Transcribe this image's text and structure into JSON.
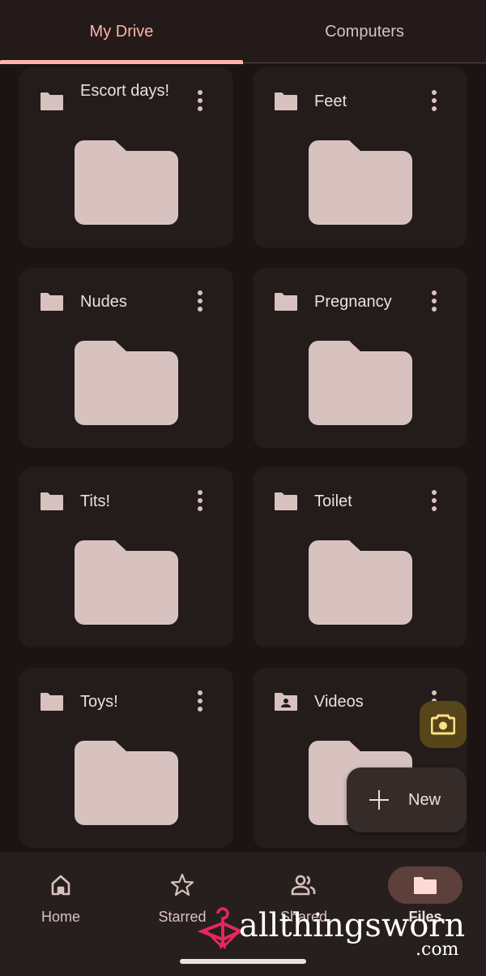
{
  "tabs": [
    {
      "label": "My Drive",
      "active": true
    },
    {
      "label": "Computers",
      "active": false
    }
  ],
  "folders": [
    {
      "name": "Escort days!",
      "icon": "folder-icon"
    },
    {
      "name": "Feet",
      "icon": "folder-icon"
    },
    {
      "name": "Nudes",
      "icon": "folder-icon"
    },
    {
      "name": "Pregnancy",
      "icon": "folder-icon"
    },
    {
      "name": "Tits!",
      "icon": "folder-icon"
    },
    {
      "name": "Toilet",
      "icon": "folder-icon"
    },
    {
      "name": "Toys!",
      "icon": "folder-icon"
    },
    {
      "name": "Videos",
      "icon": "shared-folder-icon"
    }
  ],
  "fab": {
    "camera_icon": "camera-icon",
    "new_label": "New"
  },
  "bottom_nav": [
    {
      "label": "Home",
      "icon": "home-icon",
      "active": false
    },
    {
      "label": "Starred",
      "icon": "star-icon",
      "active": false
    },
    {
      "label": "Shared",
      "icon": "shared-people-icon",
      "active": false
    },
    {
      "label": "Files",
      "icon": "folder-icon",
      "active": true
    }
  ],
  "watermark": {
    "text": "allthingsworn",
    "suffix": ".com"
  },
  "colors": {
    "accent": "#ffb4a8",
    "background": "#1b1413",
    "card": "#231c1b",
    "folder": "#d8c2c0",
    "camera_fab": "#564518",
    "watermark_pink": "#e8265e"
  }
}
